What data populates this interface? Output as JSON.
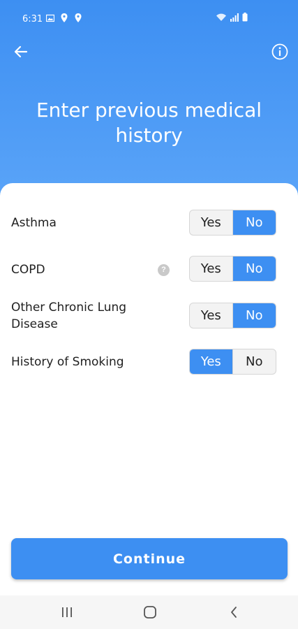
{
  "status_bar": {
    "time": "6:31",
    "left_icons": [
      "image-icon",
      "location-pin-icon",
      "location-pin-icon"
    ],
    "right_icons": [
      "wifi-icon",
      "signal-icon",
      "battery-icon"
    ]
  },
  "header": {
    "back_icon": "arrow-left-icon",
    "info_icon": "info-icon",
    "title": "Enter previous medical history",
    "color_top": "#3d8ff2",
    "color_bottom": "#5aa4f8"
  },
  "questions": [
    {
      "label": "Asthma",
      "yes_label": "Yes",
      "no_label": "No",
      "selected": "No",
      "has_help": false
    },
    {
      "label": "COPD",
      "yes_label": "Yes",
      "no_label": "No",
      "selected": "No",
      "has_help": true,
      "help_glyph": "?"
    },
    {
      "label": "Other Chronic Lung Disease",
      "yes_label": "Yes",
      "no_label": "No",
      "selected": "No",
      "has_help": false
    },
    {
      "label": "History of Smoking",
      "yes_label": "Yes",
      "no_label": "No",
      "selected": "Yes",
      "has_help": false
    }
  ],
  "continue_label": "Continue",
  "accent_color": "#3d8ff2",
  "nav_bar": {
    "recents_icon": "recents-icon",
    "home_icon": "home-icon",
    "back_icon": "nav-back-icon"
  }
}
